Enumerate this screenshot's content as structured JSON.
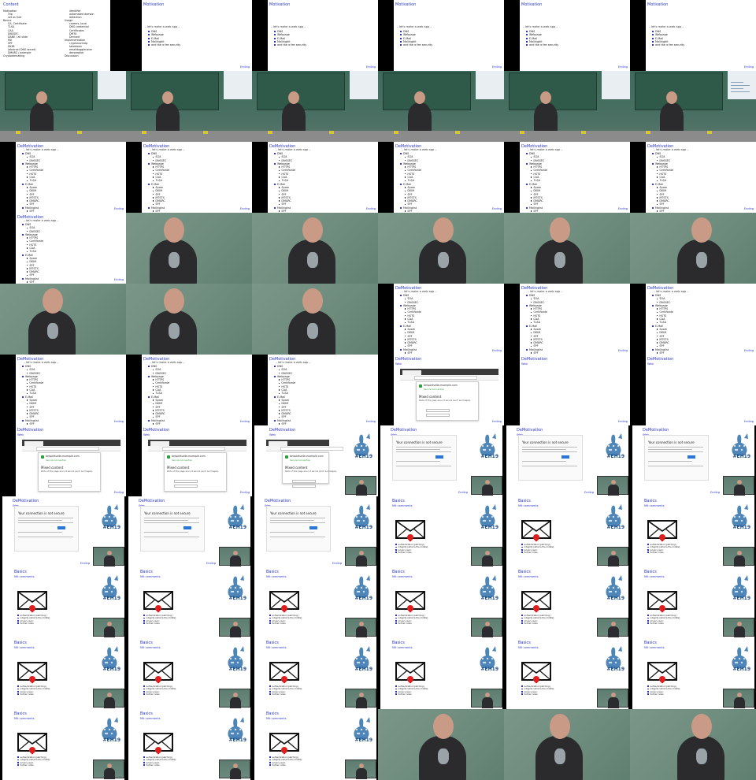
{
  "contents": {
    "title": "Content",
    "items": [
      {
        "text": "Motivation",
        "kind": "sec"
      },
      {
        "text": "Trip",
        "kind": "sub"
      },
      {
        "text": "set as free",
        "kind": "sub"
      },
      {
        "text": "Basics",
        "kind": "sec"
      },
      {
        "text": "CA, Certificate",
        "kind": "sub"
      },
      {
        "text": "TLSA",
        "kind": "sub"
      },
      {
        "text": "CAA",
        "kind": "sub"
      },
      {
        "text": "DNSSEC",
        "kind": "sub"
      },
      {
        "text": "DANE / all slide",
        "kind": "sub"
      },
      {
        "text": "MX",
        "kind": "sub"
      },
      {
        "text": "SPF",
        "kind": "sub"
      },
      {
        "text": "DKIM",
        "kind": "sub"
      },
      {
        "text": "(abstract DNS secret)",
        "kind": "sub"
      },
      {
        "text": "DMARC / example",
        "kind": "sub"
      },
      {
        "text": "Cryptodemaking",
        "kind": "sec"
      }
    ],
    "items_right": [
      {
        "text": "identifier",
        "kind": "sub"
      },
      {
        "text": "automated domain",
        "kind": "sub"
      },
      {
        "text": "detection",
        "kind": "sub"
      },
      {
        "text": "Usage",
        "kind": "sec"
      },
      {
        "text": "careers, local",
        "kind": "sub"
      },
      {
        "text": "DNS credential",
        "kind": "sub"
      },
      {
        "text": "Certificates",
        "kind": "sub"
      },
      {
        "text": "DMTA",
        "kind": "sub"
      },
      {
        "text": "Derived",
        "kind": "sub"
      },
      {
        "text": "Implementation",
        "kind": "sec"
      },
      {
        "text": "cryptocontrap",
        "kind": "sub"
      },
      {
        "text": "takedown",
        "kind": "sub"
      },
      {
        "text": "emaildoggienator",
        "kind": "sub"
      },
      {
        "text": "decompiler",
        "kind": "sub"
      },
      {
        "text": "Discussion",
        "kind": "sec"
      }
    ]
  },
  "motivation": {
    "title": "Motivation",
    "heading": "– let's make a web app –",
    "bullets": [
      "DNS",
      "Webpage",
      "E-Mail",
      "Mailingbit",
      "and the a fee security"
    ],
    "footer": "Ending"
  },
  "demotivation": {
    "title": "DeMotivation",
    "heading": "– let's make a web app –",
    "items": [
      {
        "text": "DNS",
        "kind": "top"
      },
      {
        "text": "SOA",
        "kind": "sub"
      },
      {
        "text": "DNSSEC",
        "kind": "sub"
      },
      {
        "text": "Webpage",
        "kind": "top"
      },
      {
        "text": "HTTPS",
        "kind": "sub"
      },
      {
        "text": "Certificate",
        "kind": "sub"
      },
      {
        "text": "HSTS",
        "kind": "sub"
      },
      {
        "text": "CAA",
        "kind": "sub"
      },
      {
        "text": "TLSA",
        "kind": "sub"
      },
      {
        "text": "E-Mail",
        "kind": "top"
      },
      {
        "text": "Spam",
        "kind": "sub"
      },
      {
        "text": "DKIM",
        "kind": "sub"
      },
      {
        "text": "SPF",
        "kind": "sub"
      },
      {
        "text": "MTSTS",
        "kind": "sub"
      },
      {
        "text": "DMARC",
        "kind": "sub"
      },
      {
        "text": "SPF",
        "kind": "sub"
      },
      {
        "text": "Mailinglist",
        "kind": "top"
      },
      {
        "text": "SPF",
        "kind": "sub"
      },
      {
        "text": "ARC",
        "kind": "sub"
      }
    ],
    "footer": "Ending"
  },
  "browser": {
    "title": "DeMotivation",
    "sub": "Web",
    "host": "beispielseite-example.com",
    "secure": "Secure Connection",
    "mixed": "Mixed content",
    "mixed_desc": "Parts of this page are not secure (such as images).",
    "url": "https://beispielseite.example.com",
    "footer": "Ending"
  },
  "privacy": {
    "title": "DeMotivation",
    "sub": "Web",
    "heading": "Your connection is not secure",
    "footer": "Ending"
  },
  "basics": {
    "title": "Basics",
    "sub": "Mit comments",
    "bullets": [
      "authentication (patching)",
      "integrity (what is the middle)",
      "privacy (sec)",
      "further notes"
    ],
    "logo": "#EH19"
  },
  "colors": {
    "accent": "#2a37c8",
    "eh_blue": "#1b4f8c",
    "envelope_red": "#e01e1e",
    "lock_green": "#2e9d3a",
    "board_green": "#2f5a4a"
  }
}
